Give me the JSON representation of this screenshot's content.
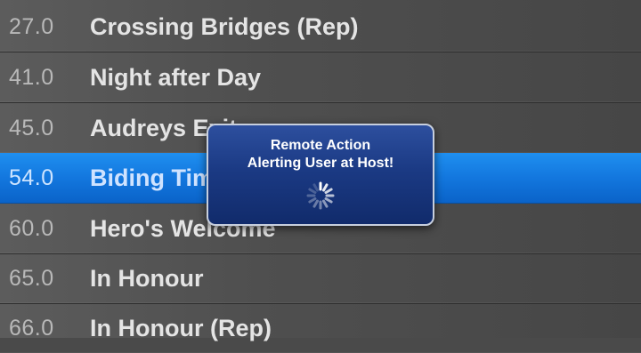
{
  "tracks": [
    {
      "time": "27.0",
      "title": "Crossing Bridges (Rep)",
      "selected": false
    },
    {
      "time": "41.0",
      "title": "Night after Day",
      "selected": false
    },
    {
      "time": "45.0",
      "title": "Audreys Exit",
      "selected": false
    },
    {
      "time": "54.0",
      "title": "Biding Time",
      "selected": true
    },
    {
      "time": "60.0",
      "title": "Hero's Welcome",
      "selected": false
    },
    {
      "time": "65.0",
      "title": "In Honour",
      "selected": false
    },
    {
      "time": "66.0",
      "title": "In Honour (Rep)",
      "selected": false
    }
  ],
  "alert": {
    "line1": "Remote Action",
    "line2": "Alerting User at Host!",
    "spinner_icon": "activity-spinner-icon"
  },
  "colors": {
    "selection": "#1377de",
    "alert_bg": "#1b3a84",
    "alert_border": "#c7cfde"
  }
}
